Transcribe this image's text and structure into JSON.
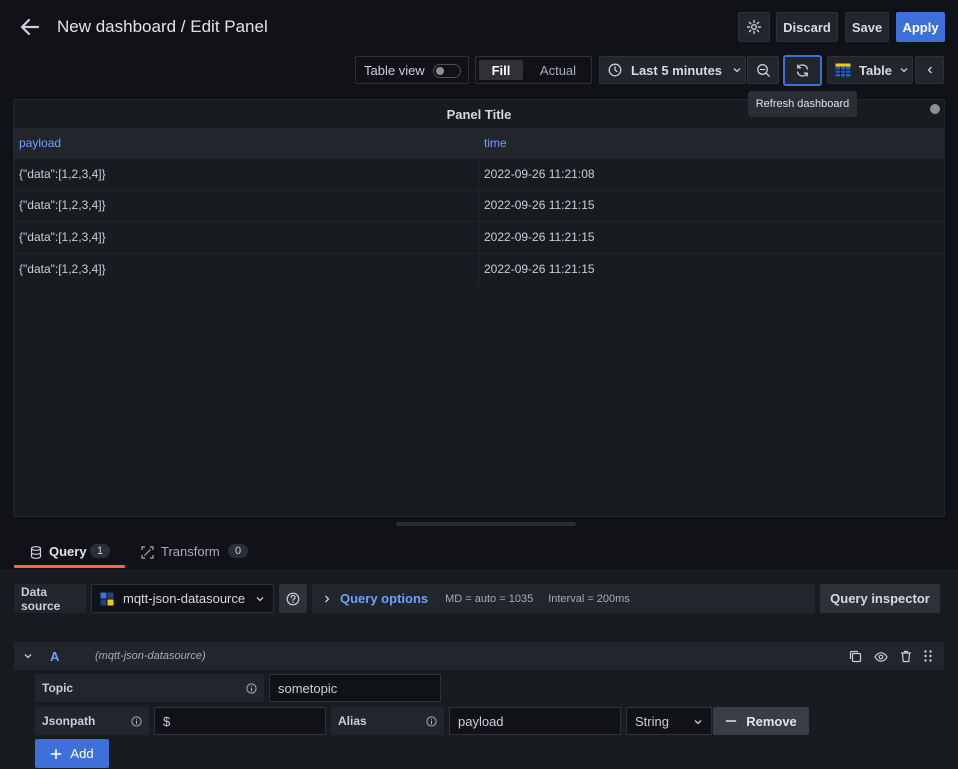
{
  "header": {
    "title": "New dashboard / Edit Panel",
    "discard_label": "Discard",
    "save_label": "Save",
    "apply_label": "Apply"
  },
  "toolbar": {
    "table_view_label": "Table view",
    "fill_label": "Fill",
    "actual_label": "Actual",
    "time_range_label": "Last 5 minutes",
    "viz_label": "Table",
    "refresh_tooltip": "Refresh dashboard"
  },
  "panel": {
    "title": "Panel Title",
    "columns": [
      "payload",
      "time"
    ],
    "rows": [
      [
        "{\"data\":[1,2,3,4]}",
        "2022-09-26 11:21:08"
      ],
      [
        "{\"data\":[1,2,3,4]}",
        "2022-09-26 11:21:15"
      ],
      [
        "{\"data\":[1,2,3,4]}",
        "2022-09-26 11:21:15"
      ],
      [
        "{\"data\":[1,2,3,4]}",
        "2022-09-26 11:21:15"
      ]
    ]
  },
  "tabs": [
    {
      "label": "Query",
      "count": "1"
    },
    {
      "label": "Transform",
      "count": "0"
    }
  ],
  "query_bar": {
    "data_source_label": "Data source",
    "data_source_value": "mqtt-json-datasource",
    "query_options_label": "Query options",
    "md_text": "MD = auto = 1035",
    "interval_text": "Interval = 200ms",
    "inspector_label": "Query inspector"
  },
  "query_row": {
    "ref_id": "A",
    "datasource_hint": "(mqtt-json-datasource)",
    "topic_label": "Topic",
    "topic_value": "sometopic",
    "jsonpath_label": "Jsonpath",
    "jsonpath_value": "$",
    "alias_label": "Alias",
    "alias_value": "payload",
    "type_value": "String",
    "remove_label": "Remove",
    "add_label": "Add"
  },
  "colors": {
    "primary": "#3d71d9",
    "link": "#6e9fff",
    "tab_underline": "#f56a3b"
  }
}
